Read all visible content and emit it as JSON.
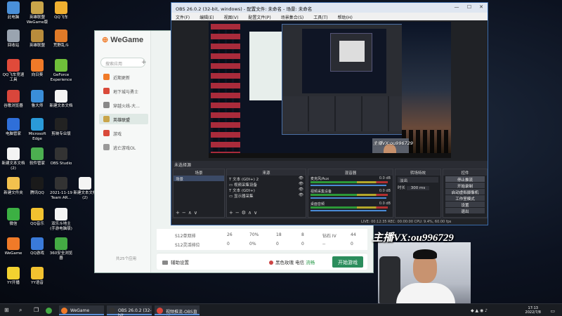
{
  "desktop_icons": [
    {
      "label": "此电脑",
      "color": "#4a90d9"
    },
    {
      "label": "英雄联盟WeGame版",
      "color": "#c9a54a"
    },
    {
      "label": "QQ飞车",
      "color": "#f0b030"
    },
    {
      "label": "回收站",
      "color": "#9aa4b0"
    },
    {
      "label": "英雄联盟",
      "color": "#b98c3c"
    },
    {
      "label": "荒野乱斗",
      "color": "#e07a28"
    },
    {
      "label": "QQ飞车竞速工具",
      "color": "#e04a3a"
    },
    {
      "label": "向日葵",
      "color": "#f07a28"
    },
    {
      "label": "GeForce Experience",
      "color": "#6fbf3a"
    },
    {
      "label": "谷歌浏览器",
      "color": "#d9463b"
    },
    {
      "label": "鲁大师",
      "color": "#3a8ed9"
    },
    {
      "label": "新建文本文档",
      "color": "#f4f4f4"
    },
    {
      "label": "电脑管家",
      "color": "#2f6fd9"
    },
    {
      "label": "Microsoft Edge",
      "color": "#2a9ad9"
    },
    {
      "label": "剪映专业版",
      "color": "#222222"
    },
    {
      "label": "新建文本文档(2)",
      "color": "#f4f4f4"
    },
    {
      "label": "软件管家",
      "color": "#4caf50"
    },
    {
      "label": "OBS Studio",
      "color": "#333333"
    },
    {
      "label": "新建文件夹",
      "color": "#f2c14e"
    },
    {
      "label": "腾讯QQ",
      "color": "#1a1a1a"
    },
    {
      "label": "2021-11-19 Team AR...",
      "color": "#333333"
    },
    {
      "label": "新建文本文档(2)",
      "color": "#f4f4f4"
    },
    {
      "label": "新建文本文档(3)",
      "color": "#f4f4f4"
    },
    {
      "label": "微信",
      "color": "#3cb043"
    },
    {
      "label": "QQ音乐",
      "color": "#f2c230"
    },
    {
      "label": "双乐斗地主(手游电脑版)",
      "color": "#f4f4f4"
    },
    {
      "label": "WeGame",
      "color": "#f07a28"
    },
    {
      "label": "QQ游戏",
      "color": "#3a7ad9"
    },
    {
      "label": "360安全浏览器",
      "color": "#44aa44"
    },
    {
      "label": "YY开播",
      "color": "#f2d230"
    },
    {
      "label": "YY语音",
      "color": "#f2c230"
    }
  ],
  "wegame": {
    "logo": "WeGame",
    "search_placeholder": "搜索应用",
    "nav": [
      {
        "label": "近期更新",
        "color": "#f07a28"
      },
      {
        "label": "地下城与勇士",
        "color": "#d94a3a"
      },
      {
        "label": "穿越火线-大...",
        "color": "#888888"
      },
      {
        "label": "英雄联盟",
        "color": "#c9a54a"
      },
      {
        "label": "游戏",
        "color": "#d94a3a"
      },
      {
        "label": "逃亡游戏OL",
        "color": "#999999"
      }
    ],
    "sidebar_footer": "共25个应用",
    "stats_rows": [
      {
        "c1": "S12单双排",
        "c2": "26",
        "c3": "70%",
        "c4": "18",
        "c5": "8",
        "c6": "钻石 IV",
        "c7": "44"
      },
      {
        "c1": "S12灵活排位",
        "c2": "0",
        "c3": "0%",
        "c4": "0",
        "c5": "0",
        "c6": "--",
        "c7": "0"
      }
    ],
    "assist_label": "辅助设置",
    "perf_label": "黑色玫瑰 电信",
    "perf_status": "流畅",
    "launch_label": "开始游戏"
  },
  "obs": {
    "title": "OBS 26.0.2 (32-bit, windows) - 配置文件: 未命名 - 场景: 未命名",
    "menu": [
      "文件(F)",
      "编辑(E)",
      "视图(V)",
      "配置文件(P)",
      "场景集合(S)",
      "工具(T)",
      "帮助(H)"
    ],
    "scene_title": "未选择源",
    "docks": {
      "scenes": {
        "header": "场景",
        "items": [
          "场景"
        ]
      },
      "sources": {
        "header": "来源",
        "items": [
          "文本 (GDI+) 2",
          "视频采集设备",
          "文本 (GDI+)",
          "显示器采集"
        ]
      },
      "mixer": {
        "header": "混音器",
        "tracks": [
          {
            "name": "麦克风/Aux",
            "db": "0.0 dB"
          },
          {
            "name": "视频采集设备",
            "db": "0.0 dB"
          },
          {
            "name": "桌面音频",
            "db": "0.0 dB"
          }
        ]
      },
      "transitions": {
        "header": "转场特效",
        "type": "淡出",
        "duration_label": "时长",
        "duration": "300 ms"
      },
      "controls": {
        "header": "控件",
        "buttons": [
          "停止推流",
          "开始录制",
          "启动虚拟摄像机",
          "工作室模式",
          "设置",
          "退出"
        ]
      }
    },
    "status": "LIVE: 00:12:35   REC: 00:00:00   CPU: 9.4%, 60.00 fps"
  },
  "watermark": "主播VX:ou996729",
  "taskbar": {
    "tasks": [
      {
        "label": "WeGame",
        "color": "#f07a28"
      },
      {
        "label": "OBS 26.0.2 (32-bit...",
        "color": "#333333"
      },
      {
        "label": "视频推流-OBS直播...",
        "color": "#d9463b"
      }
    ],
    "time": "17:13",
    "date": "2022/7/8"
  }
}
